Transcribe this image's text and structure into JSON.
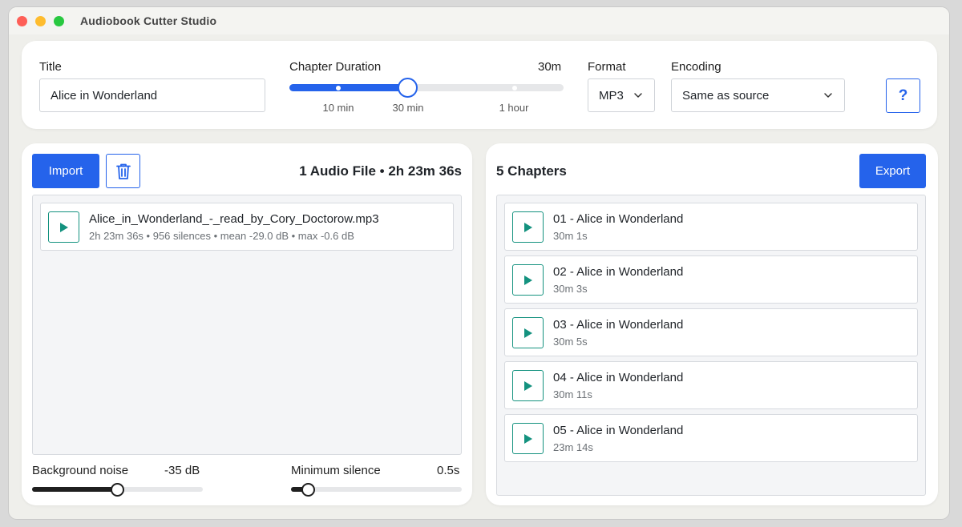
{
  "window": {
    "title": "Audiobook Cutter Studio"
  },
  "settings": {
    "title_label": "Title",
    "title_value": "Alice in Wonderland",
    "duration_label": "Chapter Duration",
    "duration_value": "30m",
    "duration_ticks": [
      "10 min",
      "30 min",
      "1 hour"
    ],
    "duration_level": 0.43,
    "format_label": "Format",
    "format_value": "MP3",
    "encoding_label": "Encoding",
    "encoding_value": "Same as source",
    "help_label": "?"
  },
  "files_panel": {
    "import_label": "Import",
    "summary": "1 Audio File • 2h 23m 36s",
    "files": [
      {
        "name": "Alice_in_Wonderland_-_read_by_Cory_Doctorow.mp3",
        "details": "2h 23m 36s • 956 silences • mean -29.0 dB • max -0.6 dB"
      }
    ],
    "noise_label": "Background noise",
    "noise_value": "-35 dB",
    "noise_level": 0.5,
    "silence_label": "Minimum silence",
    "silence_value": "0.5s",
    "silence_level": 0.1
  },
  "chapters_panel": {
    "heading": "5 Chapters",
    "export_label": "Export",
    "chapters": [
      {
        "title": "01 - Alice in Wonderland",
        "duration": "30m 1s"
      },
      {
        "title": "02 - Alice in Wonderland",
        "duration": "30m 3s"
      },
      {
        "title": "03 - Alice in Wonderland",
        "duration": "30m 5s"
      },
      {
        "title": "04 - Alice in Wonderland",
        "duration": "30m 11s"
      },
      {
        "title": "05 - Alice in Wonderland",
        "duration": "23m 14s"
      }
    ]
  },
  "colors": {
    "accent": "#2563eb",
    "play_accent": "#14927f"
  },
  "icons": {
    "delete": "trash-icon",
    "play": "play-icon",
    "dropdown": "chevron-down-icon"
  }
}
